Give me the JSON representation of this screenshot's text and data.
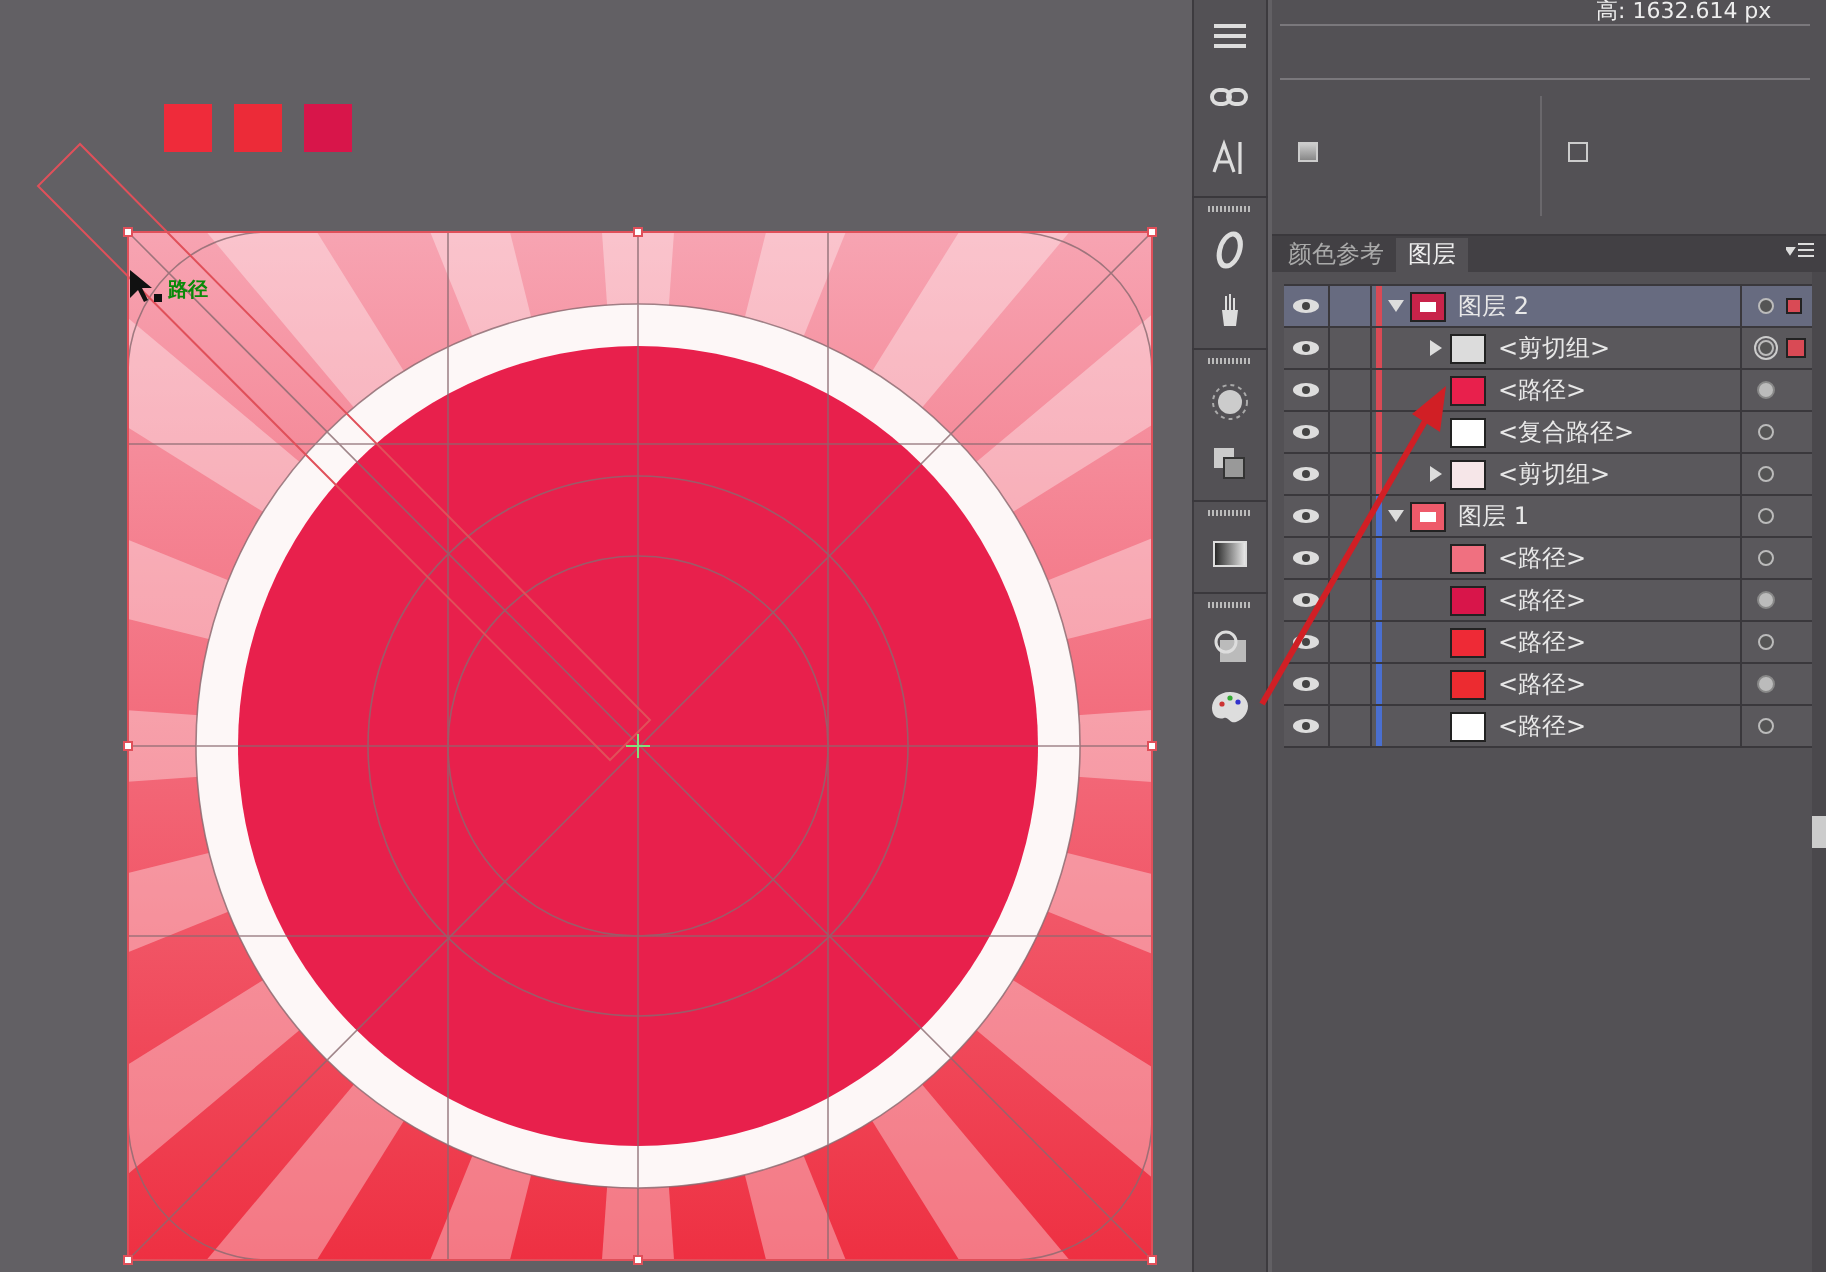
{
  "canvas": {
    "swatches": [
      {
        "color": "#ef2b3a"
      },
      {
        "color": "#ec2b38"
      },
      {
        "color": "#d8154a"
      }
    ],
    "smart_guide": "路径"
  },
  "properties": {
    "height_readout": "高: 1632.614 px",
    "checkboxes": [
      {
        "checked": true
      },
      {
        "checked": false
      }
    ]
  },
  "panel_tabs": [
    {
      "label": "颜色参考",
      "selected": false
    },
    {
      "label": "图层",
      "selected": true
    }
  ],
  "layers": [
    {
      "name": "图层 2",
      "color": "#d94a55",
      "active": true,
      "expanded": true,
      "visible": true,
      "appearance": false,
      "selected": false,
      "children": [
        {
          "name": "<剪切组>",
          "color": "#dcdcdc",
          "expanded": false,
          "visible": true,
          "appearance": false,
          "selected": true
        },
        {
          "name": "<路径>",
          "color": "#e8204c",
          "visible": true,
          "appearance": true,
          "selected": false
        },
        {
          "name": "<复合路径>",
          "color": "#ffffff",
          "visible": true,
          "appearance": false,
          "selected": false
        },
        {
          "name": "<剪切组>",
          "color": "#f6e6e8",
          "expanded": false,
          "visible": true,
          "appearance": false,
          "selected": false
        }
      ]
    },
    {
      "name": "图层 1",
      "color": "#4a6fd0",
      "active": false,
      "expanded": true,
      "visible": true,
      "appearance": false,
      "selected": false,
      "children": [
        {
          "name": "<路径>",
          "color": "#f07080",
          "visible": true,
          "appearance": false,
          "selected": false
        },
        {
          "name": "<路径>",
          "color": "#d8154a",
          "visible": true,
          "appearance": true,
          "selected": false
        },
        {
          "name": "<路径>",
          "color": "#ee2a36",
          "visible": true,
          "appearance": false,
          "selected": false
        },
        {
          "name": "<路径>",
          "color": "#ec2b30",
          "visible": true,
          "appearance": true,
          "selected": false
        },
        {
          "name": "<路径>",
          "color": "#ffffff",
          "visible": true,
          "appearance": false,
          "selected": false
        }
      ]
    }
  ]
}
